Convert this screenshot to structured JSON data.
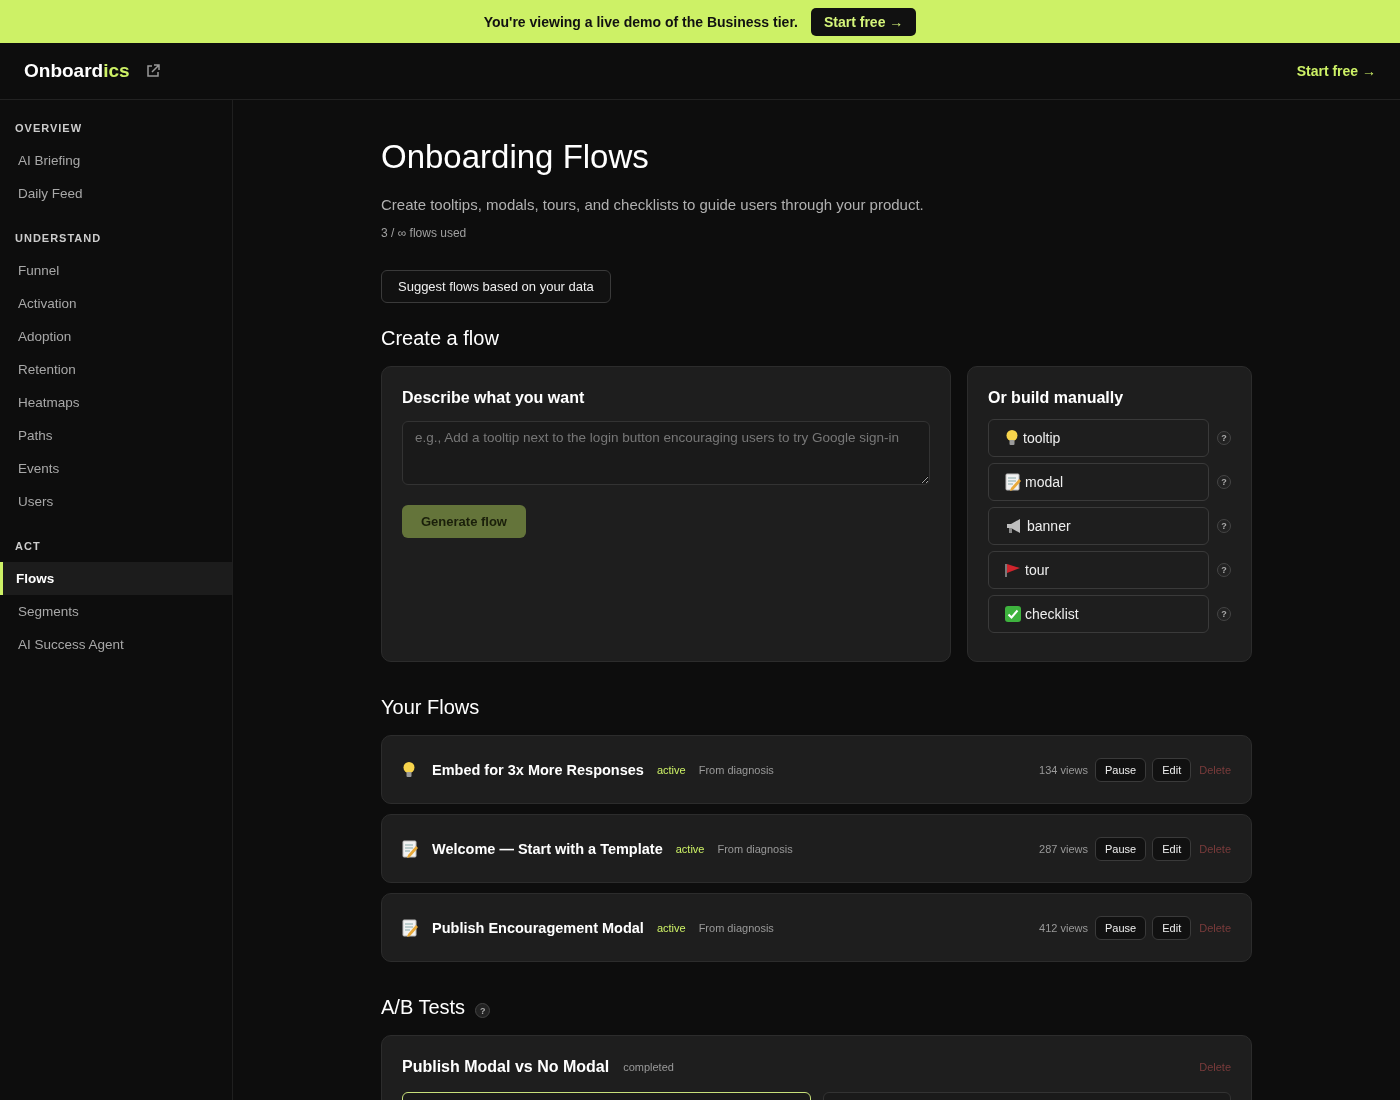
{
  "banner": {
    "text": "You're viewing a live demo of the Business tier.",
    "button": "Start free →"
  },
  "header": {
    "logo_main": "Onboard",
    "logo_accent": "ics",
    "cta": "Start free →"
  },
  "sidebar": {
    "sections": [
      {
        "title": "OVERVIEW",
        "items": [
          {
            "label": "AI Briefing",
            "selected": false
          },
          {
            "label": "Daily Feed",
            "selected": false
          }
        ]
      },
      {
        "title": "UNDERSTAND",
        "items": [
          {
            "label": "Funnel",
            "selected": false
          },
          {
            "label": "Activation",
            "selected": false
          },
          {
            "label": "Adoption",
            "selected": false
          },
          {
            "label": "Retention",
            "selected": false
          },
          {
            "label": "Heatmaps",
            "selected": false
          },
          {
            "label": "Paths",
            "selected": false
          },
          {
            "label": "Events",
            "selected": false
          },
          {
            "label": "Users",
            "selected": false
          }
        ]
      },
      {
        "title": "ACT",
        "items": [
          {
            "label": "Flows",
            "selected": true
          },
          {
            "label": "Segments",
            "selected": false
          },
          {
            "label": "AI Success Agent",
            "selected": false
          }
        ]
      }
    ]
  },
  "page": {
    "title": "Onboarding Flows",
    "description": "Create tooltips, modals, tours, and checklists to guide users through your product.",
    "usage": "3 / ∞ flows used",
    "suggest_button": "Suggest flows based on your data"
  },
  "create": {
    "heading": "Create a flow",
    "describe_title": "Describe what you want",
    "placeholder": "e.g., Add a tooltip next to the login button encouraging users to try Google sign-in",
    "generate_button": "Generate flow",
    "manual_title": "Or build manually",
    "types": [
      {
        "kind": "tooltip",
        "label": "tooltip",
        "help": "?"
      },
      {
        "kind": "modal",
        "label": "modal",
        "help": "?"
      },
      {
        "kind": "banner",
        "label": "banner",
        "help": "?"
      },
      {
        "kind": "tour",
        "label": "tour",
        "help": "?"
      },
      {
        "kind": "checklist",
        "label": "checklist",
        "help": "?"
      }
    ]
  },
  "flows": {
    "heading": "Your Flows",
    "items": [
      {
        "kind": "tooltip",
        "name": "Embed for 3x More Responses",
        "status": "active",
        "source": "From diagnosis",
        "views": "134 views",
        "pause": "Pause",
        "edit": "Edit",
        "delete": "Delete"
      },
      {
        "kind": "modal",
        "name": "Welcome — Start with a Template",
        "status": "active",
        "source": "From diagnosis",
        "views": "287 views",
        "pause": "Pause",
        "edit": "Edit",
        "delete": "Delete"
      },
      {
        "kind": "modal",
        "name": "Publish Encouragement Modal",
        "status": "active",
        "source": "From diagnosis",
        "views": "412 views",
        "pause": "Pause",
        "edit": "Edit",
        "delete": "Delete"
      }
    ]
  },
  "ab_tests": {
    "heading": "A/B Tests",
    "help": "?",
    "items": [
      {
        "name": "Publish Modal vs No Modal",
        "status": "completed",
        "delete": "Delete",
        "variants": [
          {
            "winner": true
          },
          {
            "winner": false
          }
        ]
      }
    ]
  }
}
